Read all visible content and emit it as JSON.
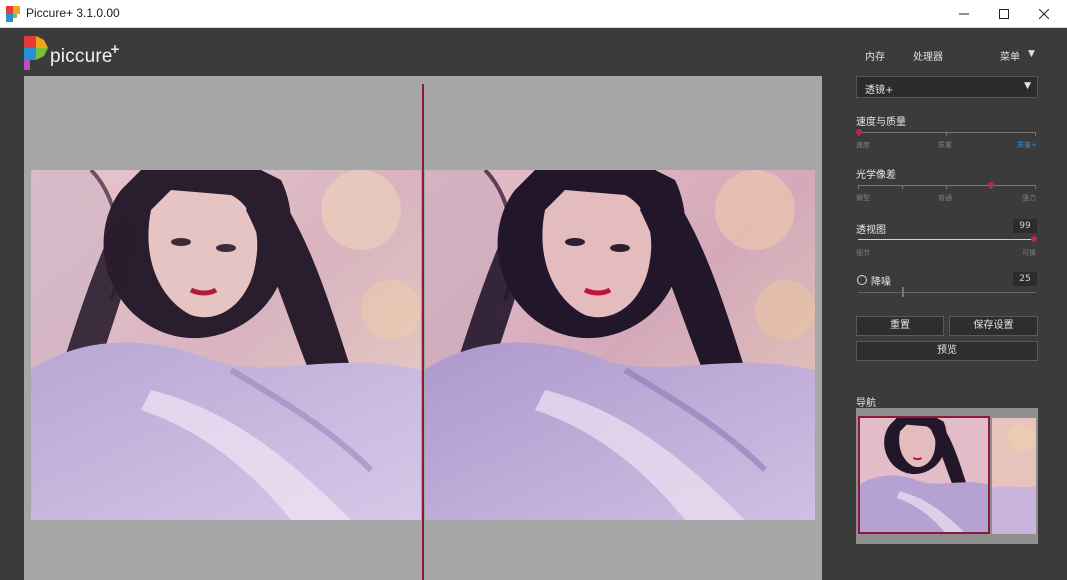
{
  "window": {
    "title": "Piccure+ 3.1.0.00"
  },
  "logo": {
    "word": "piccure",
    "plus": "+"
  },
  "topnav": {
    "memory": "内存",
    "processor": "处理器",
    "menu": "菜单"
  },
  "filter": {
    "selected": "透镜+"
  },
  "speed_quality": {
    "label": "速度与质量",
    "ticks": [
      "速度",
      "质量",
      "质量+"
    ],
    "value": 0
  },
  "optical": {
    "label": "光学像差",
    "ticks": [
      "微型",
      "普通",
      "强力"
    ],
    "value": 0.75
  },
  "perspective": {
    "label": "透视图",
    "value": "99",
    "ticks": [
      "细节",
      "可换"
    ],
    "level": 0.99
  },
  "denoise": {
    "label": "降噪",
    "value": "25",
    "level": 0.25
  },
  "buttons": {
    "reset": "重置",
    "save_settings": "保存设置",
    "preview": "预览"
  },
  "navigator": {
    "label": "导航"
  },
  "colors": {
    "accent": "#8b1a3c",
    "blue": "#2a8fd6",
    "panel_bg": "#3b3b3b",
    "preview_bg": "#a6a6a6"
  }
}
